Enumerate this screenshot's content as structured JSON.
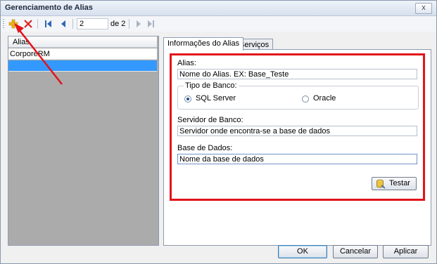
{
  "window": {
    "title": "Gerenciamento de Alias",
    "close_label": "x"
  },
  "toolbar": {
    "icons": [
      "add-icon",
      "delete-icon",
      "first-icon",
      "prev-icon",
      "next-icon",
      "last-icon"
    ],
    "page_value": "2",
    "page_of": "de 2"
  },
  "list": {
    "header": "Alias",
    "rows": [
      "CorporeRM",
      ""
    ]
  },
  "tabs": [
    "Informações do Alias",
    "Serviços"
  ],
  "form": {
    "alias_label": "Alias:",
    "alias_value": "Nome do Alias. EX: Base_Teste",
    "db_type_title": "Tipo de Banco:",
    "db_options": [
      "SQL Server",
      "Oracle"
    ],
    "db_selected": "SQL Server",
    "server_label": "Servidor de Banco:",
    "server_value": "Servidor onde encontra-se a base de dados",
    "database_label": "Base de Dados:",
    "database_value": "Nome da base de dados",
    "test_button": "Testar"
  },
  "footer": {
    "ok": "OK",
    "cancel": "Cancelar",
    "apply": "Aplicar"
  },
  "colors": {
    "highlight_border": "#e2131b",
    "arrow": "#e2131b",
    "selection": "#3399ff"
  }
}
